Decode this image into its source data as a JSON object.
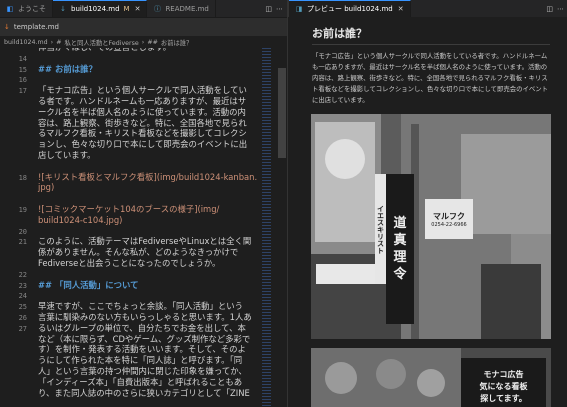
{
  "left_tabs": [
    {
      "label": "ようこそ",
      "active": false
    },
    {
      "label": "build1024.md",
      "modified": "M",
      "active": true
    },
    {
      "label": "README.md",
      "active": false
    }
  ],
  "template_tab": "template.md",
  "breadcrumb": [
    "build1024.md",
    "#",
    "私と同人活動とFediverse",
    "##",
    "お前は誰？"
  ],
  "gutter": [
    "14",
    "15",
    "16",
    "17",
    "",
    "",
    "",
    "",
    "",
    "",
    "18",
    "19",
    "",
    "20",
    "21",
    "",
    "22",
    "23",
    "",
    "24",
    "25",
    "26",
    "27"
  ],
  "editor_lines": [
    {
      "text": "体当かくはし、ての宣言とします。",
      "cls": ""
    },
    {
      "text": "",
      "cls": ""
    },
    {
      "text": "## お前は誰？",
      "cls": "h2"
    },
    {
      "text": "",
      "cls": ""
    },
    {
      "text": "「モナコ広告」という個人サークルで同人活動をしてい",
      "cls": ""
    },
    {
      "text": "る者です。ハンドルネームも一応ありますが、最近はサ",
      "cls": ""
    },
    {
      "text": "ークル名を半ば個人名のように使っています。活動の内",
      "cls": ""
    },
    {
      "text": "容は、路上観察、街歩きなど。特に、全国各地で見られ",
      "cls": ""
    },
    {
      "text": "るマルフク看板・キリスト看板などを撮影してコレクシ",
      "cls": ""
    },
    {
      "text": "ョンし、色々な切り口で本にして即売会のイベントに出",
      "cls": ""
    },
    {
      "text": "店しています。",
      "cls": ""
    },
    {
      "text": "",
      "cls": ""
    },
    {
      "text": "![キリスト看板とマルフク看板](img/build1024-kanban.",
      "cls": "link"
    },
    {
      "text": "jpg)",
      "cls": "link"
    },
    {
      "text": "",
      "cls": ""
    },
    {
      "text": "![コミックマーケット104のブースの様子](img/",
      "cls": "link"
    },
    {
      "text": "build1024-c104.jpg)",
      "cls": "link"
    },
    {
      "text": "",
      "cls": ""
    },
    {
      "text": "このように、活動テーマはFediverseやLinuxとは全く関",
      "cls": ""
    },
    {
      "text": "係がありません。そんな私が、どのようなきっかけで",
      "cls": ""
    },
    {
      "text": "Fediverseと出会うことになったのでしょうか。",
      "cls": ""
    },
    {
      "text": "",
      "cls": ""
    },
    {
      "text": "## 「同人活動」について",
      "cls": "h2"
    },
    {
      "text": "",
      "cls": ""
    },
    {
      "text": "早速ですが、ここでちょっと余談。「同人活動」という",
      "cls": ""
    },
    {
      "text": "言葉に馴染みのない方もいらっしゃると思います。1人あ",
      "cls": ""
    },
    {
      "text": "るいはグループの単位で、自分たちでお金を出して、本",
      "cls": ""
    },
    {
      "text": "など（本に限らず、CDやゲーム、グッズ制作など多彩で",
      "cls": ""
    },
    {
      "text": "す）を制作・発表する活動をいいます。そして、そのよ",
      "cls": ""
    },
    {
      "text": "うにして作られた本を特に「同人誌」と呼びます。「同",
      "cls": ""
    },
    {
      "text": "人」という言葉の持つ仲間内に閉じた印象を嫌ってか、",
      "cls": ""
    },
    {
      "text": "「インディーズ本」「自費出版本」と呼ばれることもあ",
      "cls": ""
    },
    {
      "text": "り、また同人誌の中のさらに狭いカテゴリとして「ZINE",
      "cls": ""
    }
  ],
  "right_tab": {
    "label": "プレビュー build1024.md"
  },
  "preview": {
    "heading": "お前は誰？",
    "para": "「モナコ広告」という個人サークルで同人活動をしている者です。ハンドルネームも一応ありますが、最近はサークル名を半ば個人名のように使っています。活動の内容は、路上観察、街歩きなど。特に、全国各地で見られるマルフク看板・キリスト看板などを撮影してコレクションし、色々な切り口で本にして即売会のイベントに出店しています。",
    "photo1_signs": [
      "道",
      "真",
      "理",
      "令",
      "イエスキリスト",
      "マルフク",
      "0254-22-6966"
    ],
    "photo2_signs": [
      "モナコ広告",
      "気になる看板",
      "探してます。"
    ]
  }
}
